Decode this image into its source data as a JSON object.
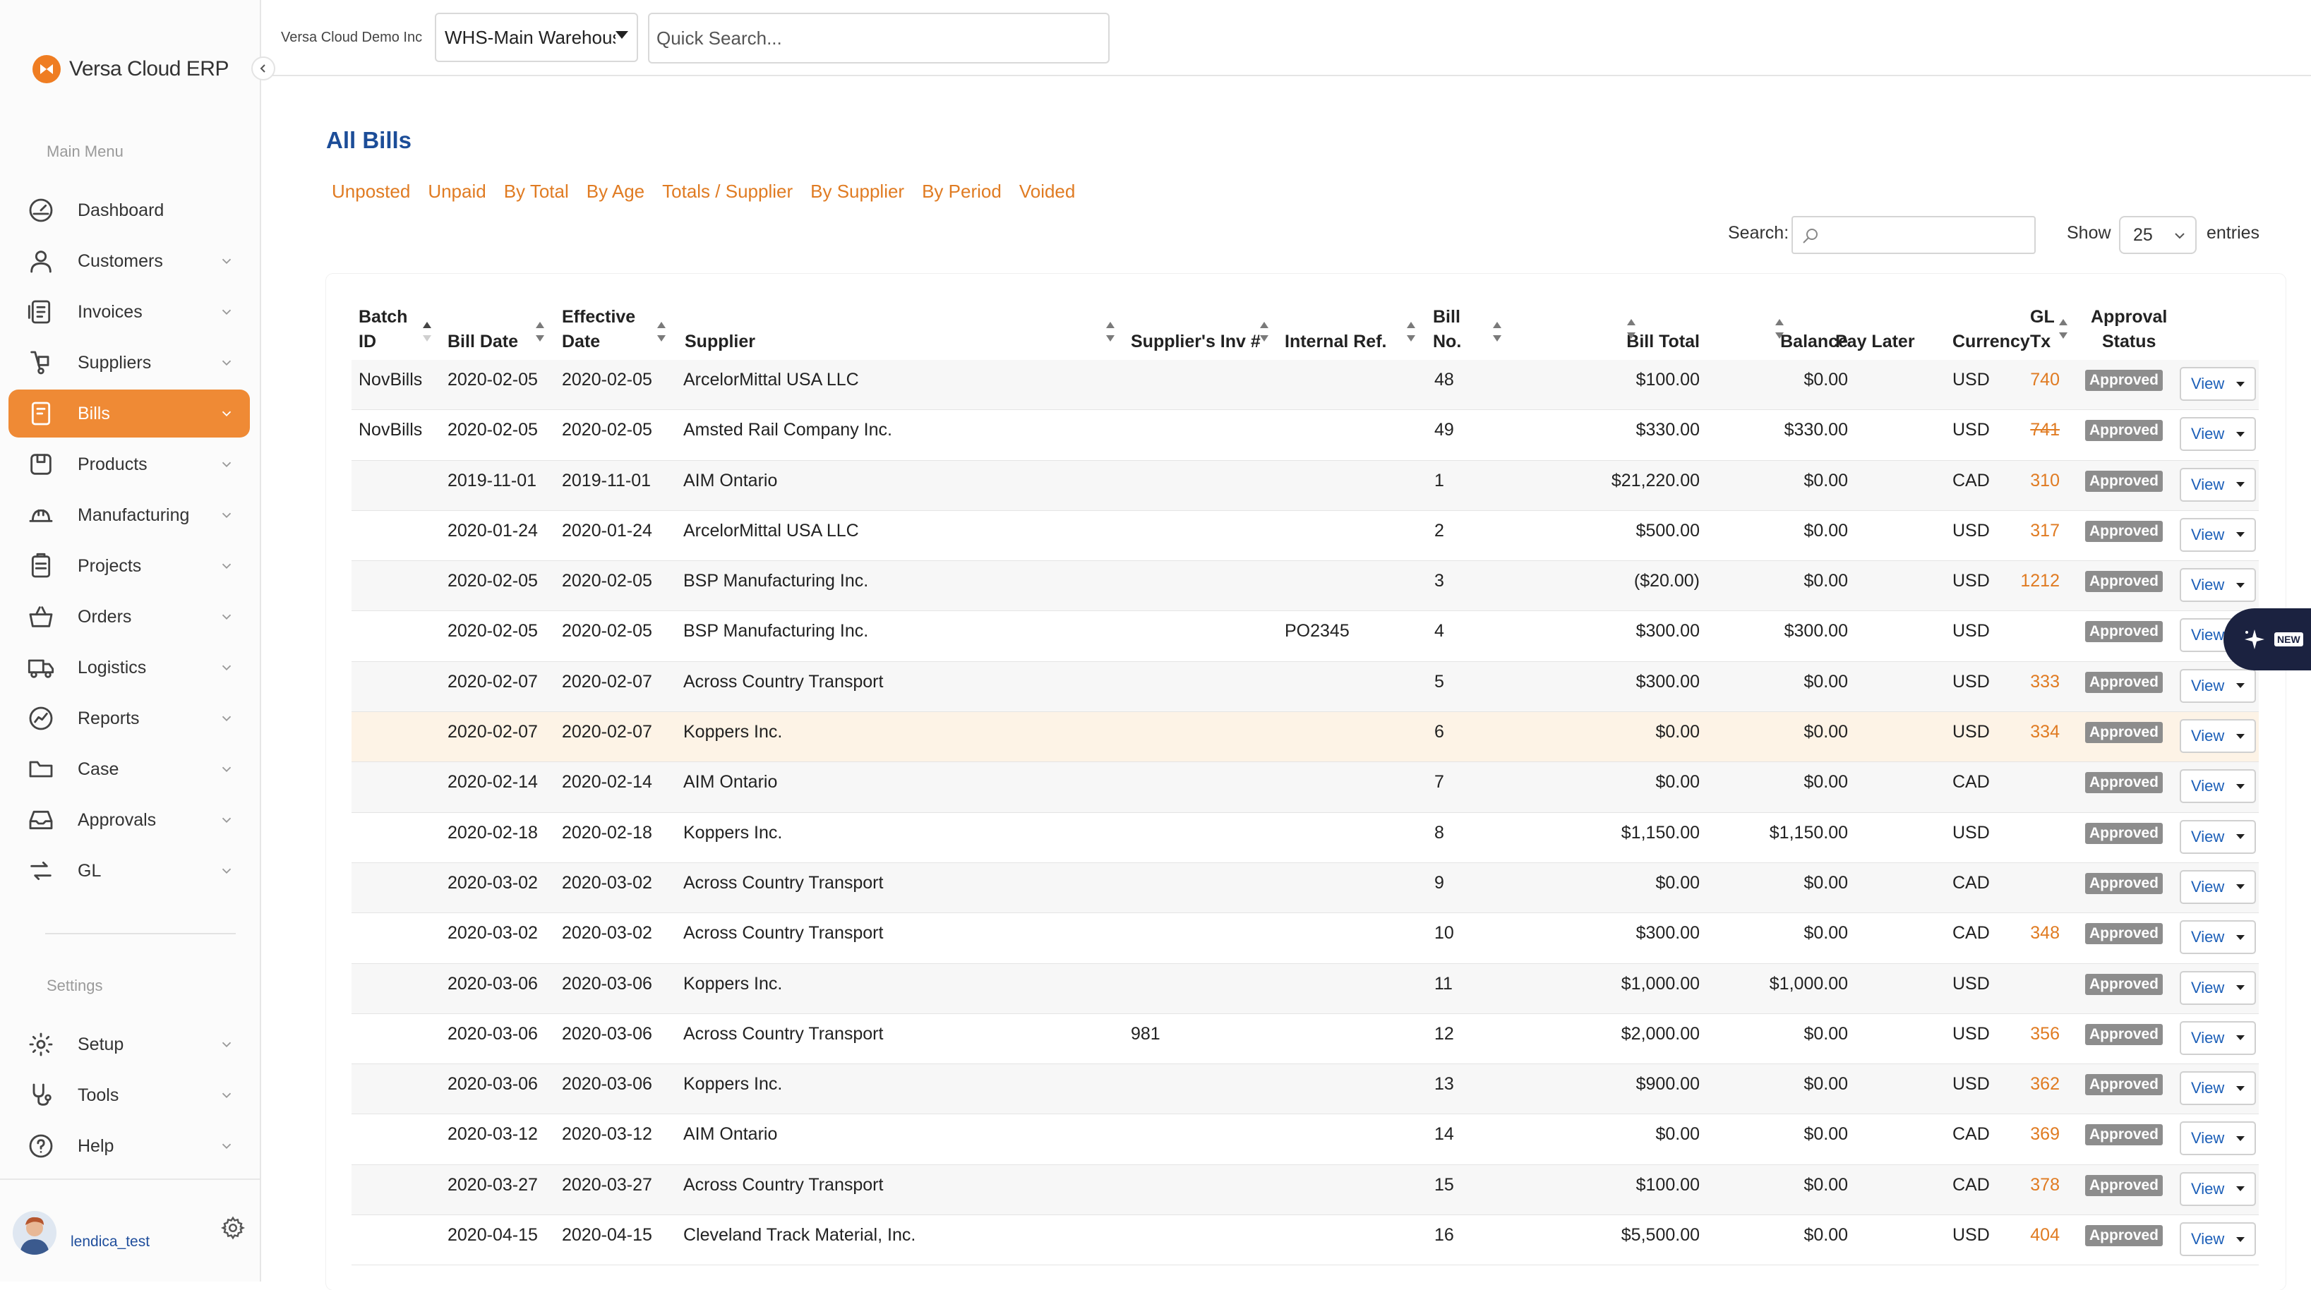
{
  "app": {
    "logo_text": "Versa Cloud ERP",
    "company": "Versa Cloud Demo Inc",
    "warehouse": "WHS-Main Warehouse",
    "quick_search_placeholder": "Quick Search...",
    "accent_color": "#ef8a35",
    "link_color": "#e07b22",
    "title_color": "#1c4d98"
  },
  "sidebar": {
    "main_menu_label": "Main Menu",
    "settings_label": "Settings",
    "main_items": [
      {
        "label": "Dashboard",
        "icon": "dashboard-icon",
        "chevron": false
      },
      {
        "label": "Customers",
        "icon": "user-icon",
        "chevron": true
      },
      {
        "label": "Invoices",
        "icon": "invoice-icon",
        "chevron": true
      },
      {
        "label": "Suppliers",
        "icon": "truck-dolly-icon",
        "chevron": true
      },
      {
        "label": "Bills",
        "icon": "bill-icon",
        "chevron": true,
        "active": true
      },
      {
        "label": "Products",
        "icon": "box-icon",
        "chevron": true
      },
      {
        "label": "Manufacturing",
        "icon": "hardhat-icon",
        "chevron": true
      },
      {
        "label": "Projects",
        "icon": "clipboard-icon",
        "chevron": true
      },
      {
        "label": "Orders",
        "icon": "basket-icon",
        "chevron": true
      },
      {
        "label": "Logistics",
        "icon": "truck-icon",
        "chevron": true
      },
      {
        "label": "Reports",
        "icon": "chart-icon",
        "chevron": true
      },
      {
        "label": "Case",
        "icon": "folder-icon",
        "chevron": true
      },
      {
        "label": "Approvals",
        "icon": "inbox-icon",
        "chevron": true
      },
      {
        "label": "GL",
        "icon": "exchange-icon",
        "chevron": true
      }
    ],
    "settings_items": [
      {
        "label": "Setup",
        "icon": "gear-icon",
        "chevron": true
      },
      {
        "label": "Tools",
        "icon": "stethoscope-icon",
        "chevron": true
      },
      {
        "label": "Help",
        "icon": "help-icon",
        "chevron": true
      }
    ],
    "username": "lendica_test"
  },
  "page": {
    "title": "All Bills",
    "filters": [
      "Unposted",
      "Unpaid",
      "By Total",
      "By Age",
      "Totals / Supplier",
      "By Supplier",
      "By Period",
      "Voided"
    ],
    "search_label": "Search:",
    "show_label": "Show",
    "page_length": "25",
    "entries_label": "entries",
    "new_tag": "NEW"
  },
  "table": {
    "headers": {
      "batch_id": [
        "Batch",
        "ID"
      ],
      "bill_date": [
        "Bill Date"
      ],
      "effective_date": [
        "Effective",
        "Date"
      ],
      "supplier": [
        "Supplier"
      ],
      "supplier_inv": [
        "Supplier's Inv #"
      ],
      "internal_ref": [
        "Internal Ref."
      ],
      "bill_no": [
        "Bill",
        "No."
      ],
      "bill_total": [
        "Bill Total"
      ],
      "balance": [
        "Balance"
      ],
      "pay_later": [
        "Pay Later"
      ],
      "currency": [
        "Currency"
      ],
      "gl_tx": [
        "GL",
        "Tx"
      ],
      "approval_status": [
        "Approval",
        "Status"
      ]
    },
    "view_label": "View",
    "rows": [
      {
        "batch": "NovBills",
        "bill_date": "2020-02-05",
        "eff_date": "2020-02-05",
        "supplier": "ArcelorMittal USA LLC",
        "sup_inv": "",
        "int_ref": "",
        "bill_no": "48",
        "total": "$100.00",
        "balance": "$0.00",
        "currency": "USD",
        "gl": "740",
        "gl_void": false,
        "status": "Approved"
      },
      {
        "batch": "NovBills",
        "bill_date": "2020-02-05",
        "eff_date": "2020-02-05",
        "supplier": "Amsted Rail Company Inc.",
        "sup_inv": "",
        "int_ref": "",
        "bill_no": "49",
        "total": "$330.00",
        "balance": "$330.00",
        "currency": "USD",
        "gl": "741",
        "gl_void": true,
        "status": "Approved"
      },
      {
        "batch": "",
        "bill_date": "2019-11-01",
        "eff_date": "2019-11-01",
        "supplier": "AIM Ontario",
        "sup_inv": "",
        "int_ref": "",
        "bill_no": "1",
        "total": "$21,220.00",
        "balance": "$0.00",
        "currency": "CAD",
        "gl": "310",
        "gl_void": false,
        "status": "Approved"
      },
      {
        "batch": "",
        "bill_date": "2020-01-24",
        "eff_date": "2020-01-24",
        "supplier": "ArcelorMittal USA LLC",
        "sup_inv": "",
        "int_ref": "",
        "bill_no": "2",
        "total": "$500.00",
        "balance": "$0.00",
        "currency": "USD",
        "gl": "317",
        "gl_void": false,
        "status": "Approved"
      },
      {
        "batch": "",
        "bill_date": "2020-02-05",
        "eff_date": "2020-02-05",
        "supplier": "BSP Manufacturing Inc.",
        "sup_inv": "",
        "int_ref": "",
        "bill_no": "3",
        "total": "($20.00)",
        "balance": "$0.00",
        "currency": "USD",
        "gl": "1212",
        "gl_void": false,
        "status": "Approved"
      },
      {
        "batch": "",
        "bill_date": "2020-02-05",
        "eff_date": "2020-02-05",
        "supplier": "BSP Manufacturing Inc.",
        "sup_inv": "",
        "int_ref": "PO2345",
        "bill_no": "4",
        "total": "$300.00",
        "balance": "$300.00",
        "currency": "USD",
        "gl": "",
        "gl_void": false,
        "status": "Approved"
      },
      {
        "batch": "",
        "bill_date": "2020-02-07",
        "eff_date": "2020-02-07",
        "supplier": "Across Country Transport",
        "sup_inv": "",
        "int_ref": "",
        "bill_no": "5",
        "total": "$300.00",
        "balance": "$0.00",
        "currency": "USD",
        "gl": "333",
        "gl_void": false,
        "status": "Approved"
      },
      {
        "batch": "",
        "bill_date": "2020-02-07",
        "eff_date": "2020-02-07",
        "supplier": "Koppers Inc.",
        "sup_inv": "",
        "int_ref": "",
        "bill_no": "6",
        "total": "$0.00",
        "balance": "$0.00",
        "currency": "USD",
        "gl": "334",
        "gl_void": false,
        "status": "Approved",
        "highlight": true
      },
      {
        "batch": "",
        "bill_date": "2020-02-14",
        "eff_date": "2020-02-14",
        "supplier": "AIM Ontario",
        "sup_inv": "",
        "int_ref": "",
        "bill_no": "7",
        "total": "$0.00",
        "balance": "$0.00",
        "currency": "CAD",
        "gl": "",
        "gl_void": false,
        "status": "Approved"
      },
      {
        "batch": "",
        "bill_date": "2020-02-18",
        "eff_date": "2020-02-18",
        "supplier": "Koppers Inc.",
        "sup_inv": "",
        "int_ref": "",
        "bill_no": "8",
        "total": "$1,150.00",
        "balance": "$1,150.00",
        "currency": "USD",
        "gl": "",
        "gl_void": false,
        "status": "Approved"
      },
      {
        "batch": "",
        "bill_date": "2020-03-02",
        "eff_date": "2020-03-02",
        "supplier": "Across Country Transport",
        "sup_inv": "",
        "int_ref": "",
        "bill_no": "9",
        "total": "$0.00",
        "balance": "$0.00",
        "currency": "CAD",
        "gl": "",
        "gl_void": false,
        "status": "Approved"
      },
      {
        "batch": "",
        "bill_date": "2020-03-02",
        "eff_date": "2020-03-02",
        "supplier": "Across Country Transport",
        "sup_inv": "",
        "int_ref": "",
        "bill_no": "10",
        "total": "$300.00",
        "balance": "$0.00",
        "currency": "CAD",
        "gl": "348",
        "gl_void": false,
        "status": "Approved"
      },
      {
        "batch": "",
        "bill_date": "2020-03-06",
        "eff_date": "2020-03-06",
        "supplier": "Koppers Inc.",
        "sup_inv": "",
        "int_ref": "",
        "bill_no": "11",
        "total": "$1,000.00",
        "balance": "$1,000.00",
        "currency": "USD",
        "gl": "",
        "gl_void": false,
        "status": "Approved"
      },
      {
        "batch": "",
        "bill_date": "2020-03-06",
        "eff_date": "2020-03-06",
        "supplier": "Across Country Transport",
        "sup_inv": "981",
        "int_ref": "",
        "bill_no": "12",
        "total": "$2,000.00",
        "balance": "$0.00",
        "currency": "USD",
        "gl": "356",
        "gl_void": false,
        "status": "Approved"
      },
      {
        "batch": "",
        "bill_date": "2020-03-06",
        "eff_date": "2020-03-06",
        "supplier": "Koppers Inc.",
        "sup_inv": "",
        "int_ref": "",
        "bill_no": "13",
        "total": "$900.00",
        "balance": "$0.00",
        "currency": "USD",
        "gl": "362",
        "gl_void": false,
        "status": "Approved"
      },
      {
        "batch": "",
        "bill_date": "2020-03-12",
        "eff_date": "2020-03-12",
        "supplier": "AIM Ontario",
        "sup_inv": "",
        "int_ref": "",
        "bill_no": "14",
        "total": "$0.00",
        "balance": "$0.00",
        "currency": "CAD",
        "gl": "369",
        "gl_void": false,
        "status": "Approved"
      },
      {
        "batch": "",
        "bill_date": "2020-03-27",
        "eff_date": "2020-03-27",
        "supplier": "Across Country Transport",
        "sup_inv": "",
        "int_ref": "",
        "bill_no": "15",
        "total": "$100.00",
        "balance": "$0.00",
        "currency": "CAD",
        "gl": "378",
        "gl_void": false,
        "status": "Approved"
      },
      {
        "batch": "",
        "bill_date": "2020-04-15",
        "eff_date": "2020-04-15",
        "supplier": "Cleveland Track Material, Inc.",
        "sup_inv": "",
        "int_ref": "",
        "bill_no": "16",
        "total": "$5,500.00",
        "balance": "$0.00",
        "currency": "USD",
        "gl": "404",
        "gl_void": false,
        "status": "Approved"
      }
    ]
  }
}
